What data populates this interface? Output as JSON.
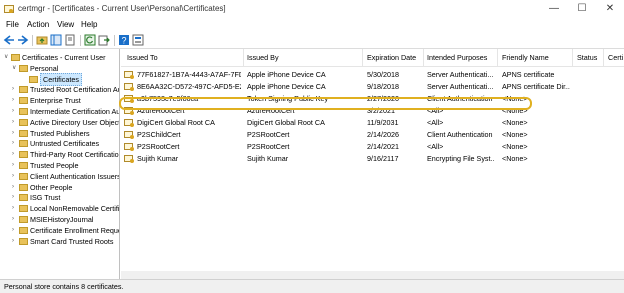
{
  "window": {
    "title": "certmgr - [Certificates - Current User\\Personal\\Certificates]",
    "min_glyph": "—",
    "max_glyph": "☐",
    "close_glyph": "✕"
  },
  "menu": [
    "File",
    "Action",
    "View",
    "Help"
  ],
  "tree": [
    {
      "label": "Certificates - Current User",
      "expander": "∨",
      "level": 0
    },
    {
      "label": "Personal",
      "expander": "∨",
      "level": 1
    },
    {
      "label": "Certificates",
      "expander": "",
      "level": 2,
      "selected": true
    },
    {
      "label": "Trusted Root Certification Au",
      "expander": "›",
      "level": 1
    },
    {
      "label": "Enterprise Trust",
      "expander": "›",
      "level": 1
    },
    {
      "label": "Intermediate Certification Au",
      "expander": "›",
      "level": 1
    },
    {
      "label": "Active Directory User Object",
      "expander": "›",
      "level": 1
    },
    {
      "label": "Trusted Publishers",
      "expander": "›",
      "level": 1
    },
    {
      "label": "Untrusted Certificates",
      "expander": "›",
      "level": 1
    },
    {
      "label": "Third-Party Root Certification",
      "expander": "›",
      "level": 1
    },
    {
      "label": "Trusted People",
      "expander": "›",
      "level": 1
    },
    {
      "label": "Client Authentication Issuers",
      "expander": "›",
      "level": 1
    },
    {
      "label": "Other People",
      "expander": "›",
      "level": 1
    },
    {
      "label": "ISG Trust",
      "expander": "›",
      "level": 1
    },
    {
      "label": "Local NonRemovable Certific",
      "expander": "›",
      "level": 1
    },
    {
      "label": "MSIEHistoryJournal",
      "expander": "›",
      "level": 1
    },
    {
      "label": "Certificate Enrollment Reque",
      "expander": "›",
      "level": 1
    },
    {
      "label": "Smart Card Trusted Roots",
      "expander": "›",
      "level": 1
    }
  ],
  "columns": [
    "Issued To",
    "Issued By",
    "Expiration Date",
    "Intended Purposes",
    "Friendly Name",
    "Status",
    "Certi"
  ],
  "rows": [
    [
      "77F61827-1B7A-4443-A7AF-7FD...",
      "Apple iPhone Device CA",
      "5/30/2018",
      "Server Authenticati...",
      "APNS certificate"
    ],
    [
      "8E6AA32C-D572-497C-AFD5-E2...",
      "Apple iPhone Device CA",
      "9/18/2018",
      "Server Authenticati...",
      "APNS certificate Dir..."
    ],
    [
      "a9b7593c7e5f86ca",
      "Token Signing Public Key",
      "2/27/2020",
      "Client Authentication",
      "<None>"
    ],
    [
      "AzureRootCert",
      "AzureRootCert",
      "3/2/2021",
      "<All>",
      "<None>"
    ],
    [
      "DigiCert Global Root CA",
      "DigiCert Global Root CA",
      "11/9/2031",
      "<All>",
      "<None>"
    ],
    [
      "P2SChildCert",
      "P2SRootCert",
      "2/14/2026",
      "Client Authentication",
      "<None>"
    ],
    [
      "P2SRootCert",
      "P2SRootCert",
      "2/14/2021",
      "<All>",
      "<None>"
    ],
    [
      "Sujith Kumar",
      "Sujith Kumar",
      "9/16/2117",
      "Encrypting File Syst...",
      "<None>"
    ]
  ],
  "status": "Personal store contains 8 certificates.",
  "colors": {
    "highlight": "#e0b020",
    "selection": "#cce8ff"
  }
}
